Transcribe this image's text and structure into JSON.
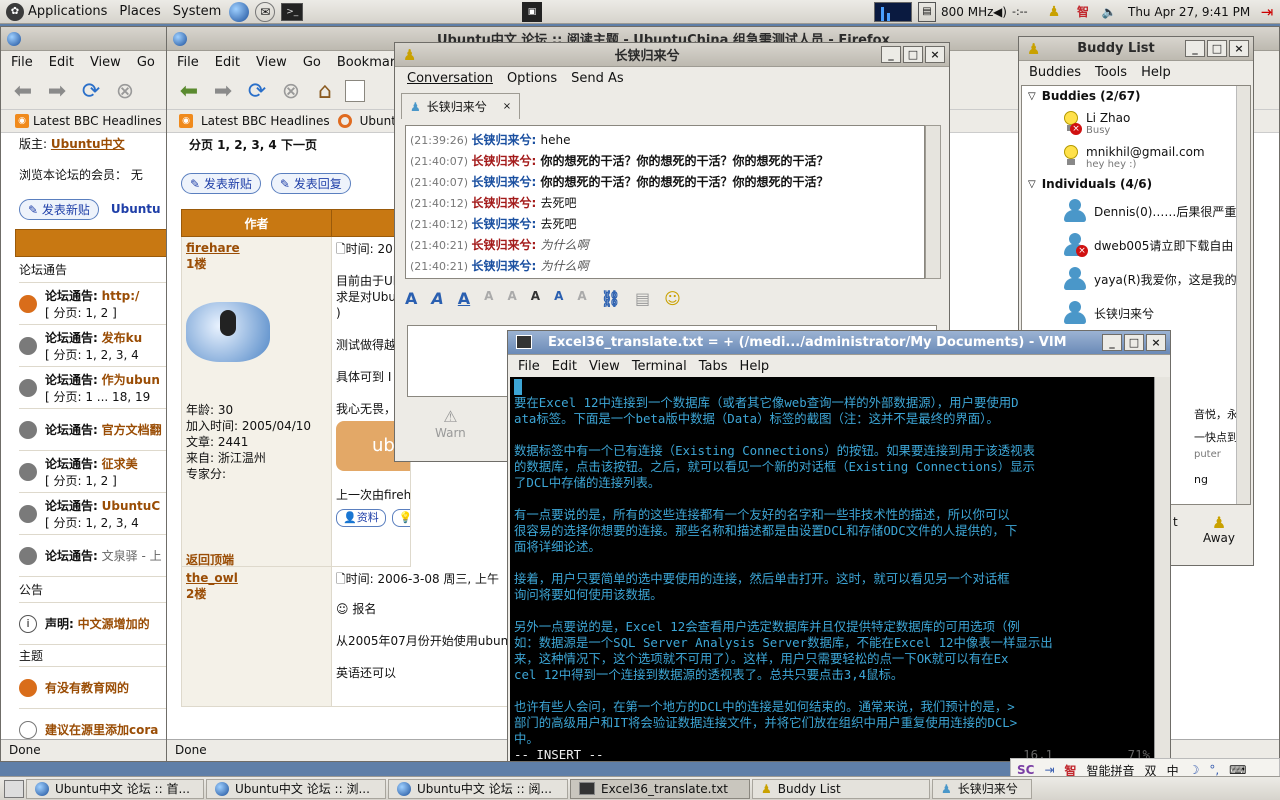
{
  "top_panel": {
    "menus": [
      "Applications",
      "Places",
      "System"
    ],
    "cpu": "800 MHz",
    "clock": "Thu Apr 27,  9:41 PM"
  },
  "bg_firefox": {
    "menu": [
      "File",
      "Edit",
      "View",
      "Go"
    ],
    "bookmark": "Latest BBC Headlines",
    "moderator_label": "版主:",
    "moderator": "Ubuntu中文",
    "browsing": "浏览本论坛的会员： 无",
    "new_post": "发表新贴",
    "forum_name": "Ubuntu",
    "sections": [
      "论坛通告",
      "公告",
      "主题"
    ],
    "rows": [
      {
        "prefix": "论坛通告:",
        "title": "http:/",
        "pages": "[ 分页: 1, 2 ]"
      },
      {
        "prefix": "论坛通告:",
        "title": "发布ku",
        "pages": "[ 分页: 1, 2, 3, 4"
      },
      {
        "prefix": "论坛通告:",
        "title": "作为ubun",
        "pages": "[ 分页: 1 ... 18, 19"
      },
      {
        "prefix": "论坛通告:",
        "title": "官方文档翻",
        "pages": ""
      },
      {
        "prefix": "论坛通告:",
        "title": "征求美",
        "pages": "[ 分页: 1, 2 ]"
      },
      {
        "prefix": "论坛通告:",
        "title": "UbuntuC",
        "pages": "[ 分页: 1, 2, 3, 4"
      },
      {
        "prefix": "论坛通告:",
        "title": "文泉驿 - 上",
        "pages": ""
      }
    ],
    "announce": {
      "prefix": "声明:",
      "title": "中文源增加的"
    },
    "topics": [
      {
        "title": "有没有教育网的"
      },
      {
        "title": "建议在源里添加cora"
      }
    ],
    "status": "Done"
  },
  "fg_firefox": {
    "title": "Ubuntu中文 论坛 :: 阅读主题 - UbuntuChina 组急需测试人员 - Firefox",
    "menu": [
      "File",
      "Edit",
      "View",
      "Go",
      "Bookmarks"
    ],
    "bookmarks": [
      "Latest BBC Headlines",
      "Ubuntu"
    ],
    "pages_label": "分页 1, 2, 3, 4  下一页",
    "btn_new": "发表新贴",
    "btn_reply": "发表回复",
    "author_header": "作者",
    "post1": {
      "author": "firehare",
      "floor": "1楼",
      "time": "时间: 20",
      "body1": "目前由于Ul",
      "body2": "求是对Ubu",
      "body3": ")",
      "body4": "测试做得越",
      "body5": "具体可到 I",
      "sig": "我心无畏，源自于我心无知。",
      "logo": "ubuntu",
      "edited": "上一次由firehare于2006-3-08",
      "age": "年龄: 30",
      "joined": "加入时间: 2005/04/10",
      "posts": "文章: 2441",
      "from": "来自: 浙江温州",
      "expert": "专家分:",
      "back": "返回顶端",
      "b_info": "资料",
      "b_off": "离线"
    },
    "post2": {
      "author": "the_owl",
      "floor": "2楼",
      "time": "时间: 2006-3-08 周三, 上午",
      "line1": "报名",
      "line2": "从2005年07月份开始使用ubun",
      "line3": "英语还可以"
    },
    "status": "Done"
  },
  "chat": {
    "title": "长铗归来兮",
    "menu": [
      "Conversation",
      "Options",
      "Send As"
    ],
    "tab": "长铗归来兮",
    "lines": [
      {
        "time": "(21:39:26)",
        "name": "长铗归来兮:",
        "msg": "hehe",
        "style": "normal",
        "me": false
      },
      {
        "time": "(21:40:07)",
        "name": "长铗归来兮:",
        "msg": "你的想死的干活？你的想死的干活？你的想死的干活？",
        "style": "bold",
        "me": true
      },
      {
        "time": "(21:40:07)",
        "name": "长铗归来兮:",
        "msg": "你的想死的干活？你的想死的干活？你的想死的干活？",
        "style": "bold",
        "me": false
      },
      {
        "time": "(21:40:12)",
        "name": "长铗归来兮:",
        "msg": "去死吧",
        "style": "normal",
        "me": true
      },
      {
        "time": "(21:40:12)",
        "name": "长铗归来兮:",
        "msg": "去死吧",
        "style": "normal",
        "me": false
      },
      {
        "time": "(21:40:21)",
        "name": "长铗归来兮:",
        "msg": "为什么啊",
        "style": "italic",
        "me": true
      },
      {
        "time": "(21:40:21)",
        "name": "长铗归来兮:",
        "msg": "为什么啊",
        "style": "italic",
        "me": false
      }
    ],
    "warn": "Warn"
  },
  "buddy": {
    "title": "Buddy List",
    "menu": [
      "Buddies",
      "Tools",
      "Help"
    ],
    "group1": "Buddies (2/67)",
    "group2": "Individuals (4/6)",
    "buddies": [
      {
        "name": "Li Zhao",
        "status": "Busy",
        "kind": "bulb",
        "bad": true
      },
      {
        "name": "mnikhil@gmail.com",
        "status": "hey hey :)",
        "kind": "bulb",
        "bad": false
      }
    ],
    "individuals": [
      {
        "name": "Dennis(0)……后果很严重",
        "kind": "person",
        "bad": false
      },
      {
        "name": "dweb005请立即下载自由",
        "kind": "person",
        "bad": true
      },
      {
        "name": "yaya(R)我爱你，这是我的",
        "kind": "person",
        "bad": false
      },
      {
        "name": "长铗归来兮",
        "kind": "person",
        "bad": false
      }
    ],
    "peek": [
      "音悦，永远",
      "一快点到中",
      "puter",
      "ng"
    ],
    "away": "Away",
    "t_partial": "t"
  },
  "vim": {
    "title": "Excel36_translate.txt = + (/medi.../administrator/My Documents) - VIM",
    "menu": [
      "File",
      "Edit",
      "View",
      "Terminal",
      "Tabs",
      "Help"
    ],
    "lines": [
      " ",
      "要在Excel 12中连接到一个数据库（或者其它像web查询一样的外部数据源），用户要使用D",
      "ata标签。下面是一个beta版中数据（Data）标签的截图（注：这并不是最终的界面）。",
      "",
      "数据标签中有一个已有连接（Existing Connections）的按钮。如果要连接到用于该透视表",
      "的数据库，点击该按钮。之后，就可以看见一个新的对话框（Existing Connections）显示",
      "了DCL中存储的连接列表。",
      "",
      "有一点要说的是，所有的这些连接都有一个友好的名字和一些非技术性的描述，所以你可以",
      "很容易的选择你想要的连接。那些名称和描述都是由设置DCL和存储ODC文件的人提供的，下",
      "面将详细论述。",
      "",
      "接着，用户只要简单的选中要使用的连接，然后单击打开。这时，就可以看见另一个对话框",
      "询问将要如何使用该数据。",
      "",
      "另外一点要说的是，Excel 12会查看用户选定数据库并且仅提供特定数据库的可用选项（例",
      "如：数据源是一个SQL Server Analysis Server数据库，不能在Excel 12中像表一样显示出",
      "来，这种情况下，这个选项就不可用了）。这样，用户只需要轻松的点一下OK就可以有在Ex",
      "cel 12中得到一个连接到数据源的透视表了。总共只要点击3,4鼠标。",
      "",
      "也许有些人会问，在第一个地方的DCL中的连接是如何结束的。通常来说，我们预计的是，>",
      "部门的高级用户和IT将会验证数据连接文件，并将它们放在组织中用户重复使用连接的DCL>",
      "中。"
    ],
    "mode": "-- INSERT --",
    "pos": "16,1",
    "pct": "71%"
  },
  "ime": {
    "name": "智能拼音",
    "shuang": "双",
    "zhong": "中"
  },
  "taskbar": [
    {
      "label": "Ubuntu中文 论坛 :: 首...",
      "icon": "firefox-icon"
    },
    {
      "label": "Ubuntu中文 论坛 :: 浏...",
      "icon": "firefox-icon"
    },
    {
      "label": "Ubuntu中文 论坛 :: 阅...",
      "icon": "firefox-icon"
    },
    {
      "label": "Excel36_translate.txt",
      "icon": "terminal-icon"
    },
    {
      "label": "Buddy List",
      "icon": "gaim-icon"
    },
    {
      "label": "长铗归来兮",
      "icon": "chat-icon"
    }
  ],
  "colors": {
    "desktop": "#5f7fa8",
    "forum_header": "#c87812",
    "vim_text": "#3da6d6",
    "chat_me": "#a31a1a",
    "chat_them": "#1a4fa0"
  }
}
